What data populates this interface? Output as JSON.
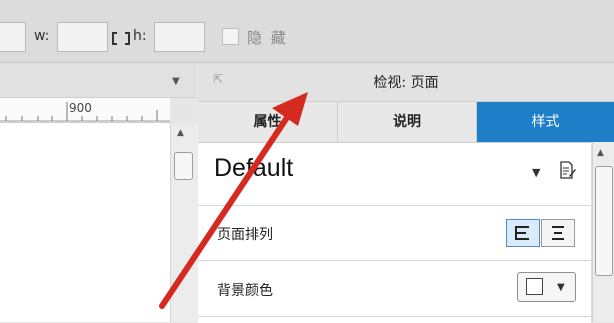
{
  "toolbar": {
    "width_label": "w:",
    "height_label": "h:",
    "hidden_label": "隐 藏"
  },
  "ruler": {
    "label": "900"
  },
  "inspector": {
    "title": "检视: 页面",
    "tabs": [
      "属性",
      "说明",
      "样式"
    ],
    "active_tab": "样式",
    "style_name": "Default",
    "rows": {
      "page_layout": "页面排列",
      "background_color": "背景颜色"
    }
  },
  "colors": {
    "active_tab": "#1e7ec8",
    "annotation_arrow": "#d42a20"
  },
  "icons": [
    "expand-icon",
    "chevron-down-icon",
    "edit-style-icon",
    "align-left-icon",
    "align-center-icon",
    "checkbox-icon"
  ]
}
